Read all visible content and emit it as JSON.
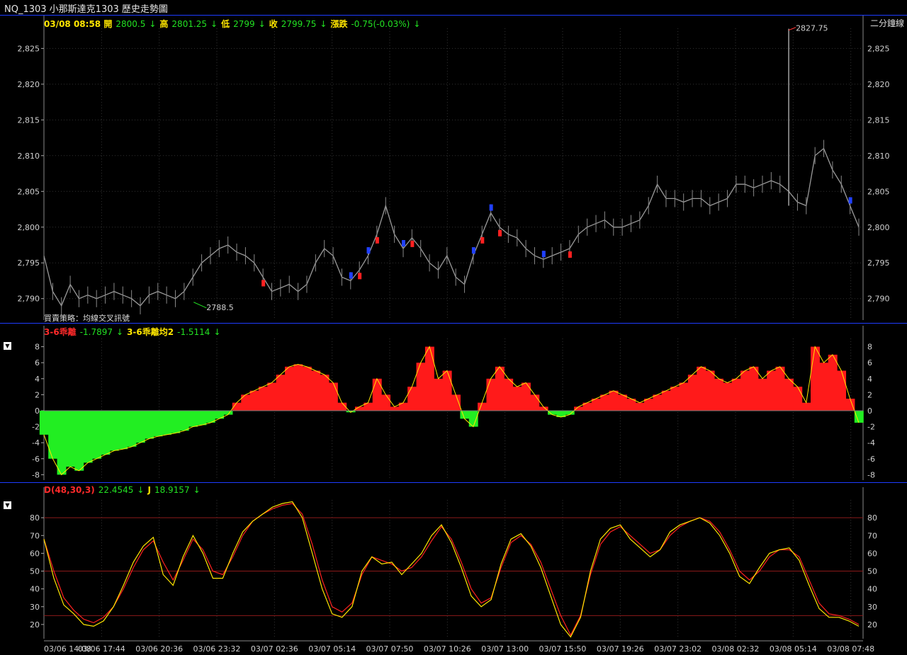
{
  "window": {
    "title": "NQ_1303 小那斯達克1303  歷史走勢圖"
  },
  "price_pane": {
    "header": [
      {
        "label": "03/08 08:58 開",
        "value": "2800.5",
        "arrow": "↓"
      },
      {
        "label": "高",
        "value": "2801.25",
        "arrow": "↓"
      },
      {
        "label": "低",
        "value": "2799",
        "arrow": "↓"
      },
      {
        "label": "收",
        "value": "2799.75",
        "arrow": "↓"
      },
      {
        "label": "漲跌",
        "value": "-0.75(-0.03%)",
        "arrow": "↓"
      }
    ],
    "right_label": "二分鐘線",
    "strategy_label": "買賣策略：均線交叉訊號",
    "high_marker": "2827.75",
    "low_marker": "2788.5",
    "y_ticks": [
      "2,825",
      "2,820",
      "2,815",
      "2,810",
      "2,805",
      "2,800",
      "2,795",
      "2,790"
    ]
  },
  "osc_pane": {
    "toggle": "▼",
    "header": [
      {
        "label": "3-6乖離",
        "value": "-1.7897",
        "arrow": "↓",
        "color": "red"
      },
      {
        "label": "3-6乖離均2",
        "value": "-1.5114",
        "arrow": "↓",
        "color": "yellow"
      }
    ],
    "y_ticks": [
      "8",
      "6",
      "4",
      "2",
      "0",
      "-2",
      "-4",
      "-6",
      "-8"
    ]
  },
  "kd_pane": {
    "toggle": "▼",
    "header": [
      {
        "label": "D(48,30,3)",
        "value": "22.4545",
        "arrow": "↓",
        "color": "red"
      },
      {
        "label": "J",
        "value": "18.9157",
        "arrow": "↓",
        "color": "yellow"
      }
    ],
    "y_ticks": [
      "80",
      "70",
      "60",
      "50",
      "40",
      "30",
      "20"
    ]
  },
  "x_ticks": [
    "03/06 14:08",
    "03/06 17:44",
    "03/06 20:36",
    "03/06 23:32",
    "03/07 02:36",
    "03/07 05:14",
    "03/07 07:50",
    "03/07 10:26",
    "03/07 13:00",
    "03/07 15:50",
    "03/07 19:26",
    "03/07 23:02",
    "03/08 02:32",
    "03/08 05:14",
    "03/08 07:48"
  ],
  "chart_data": [
    {
      "type": "line",
      "name": "price",
      "ylim": [
        2787,
        2829
      ],
      "y": [
        2796,
        2791,
        2789,
        2792,
        2790,
        2790.5,
        2790,
        2790.5,
        2791,
        2790.5,
        2790,
        2789,
        2790.5,
        2791,
        2790.5,
        2790,
        2791,
        2793,
        2795,
        2796,
        2797,
        2797.5,
        2796.5,
        2796,
        2795,
        2793,
        2791,
        2791.5,
        2792,
        2791,
        2792,
        2795,
        2797,
        2796,
        2793,
        2792.5,
        2794,
        2796,
        2799,
        2803,
        2799,
        2797,
        2798.5,
        2797,
        2795,
        2794,
        2796,
        2793,
        2792,
        2796,
        2799,
        2802,
        2800,
        2799,
        2798.5,
        2797,
        2796,
        2795.5,
        2796,
        2796.5,
        2797,
        2799,
        2800,
        2800.5,
        2801,
        2800,
        2800,
        2800.5,
        2801,
        2803,
        2806,
        2804,
        2804,
        2803.5,
        2804,
        2804,
        2803,
        2803.5,
        2804,
        2806,
        2806,
        2805.5,
        2806,
        2806.5,
        2806,
        2805,
        2803.5,
        2803,
        2810,
        2811,
        2808,
        2806,
        2803,
        2800
      ],
      "spike": 2827.75
    },
    {
      "type": "bar",
      "name": "3-6乖離",
      "ylim": [
        -9,
        9
      ],
      "values": [
        -3,
        -6,
        -8,
        -7,
        -7.5,
        -6.5,
        -6,
        -5.5,
        -5,
        -4.8,
        -4.5,
        -4,
        -3.5,
        -3.2,
        -3,
        -2.8,
        -2.5,
        -2,
        -1.8,
        -1.5,
        -1,
        -0.5,
        1,
        2,
        2.5,
        3,
        3.5,
        4.5,
        5.5,
        5.8,
        5.5,
        5,
        4.5,
        3.5,
        1,
        -0.2,
        0.5,
        1,
        4,
        2,
        0.5,
        1,
        3,
        6,
        8,
        4,
        5,
        2,
        -1,
        -2,
        1,
        4,
        5.5,
        4,
        3,
        3.5,
        2,
        0.5,
        -0.5,
        -0.8,
        -0.5,
        0.5,
        1,
        1.5,
        2,
        2.5,
        2,
        1.5,
        1,
        1.5,
        2,
        2.5,
        3,
        3.5,
        4.5,
        5.5,
        5,
        4,
        3.5,
        4,
        5,
        5.5,
        4,
        5,
        5.5,
        4,
        3,
        1,
        8,
        6,
        7,
        5,
        1.5,
        -1.5
      ]
    },
    {
      "type": "line",
      "name": "KD",
      "ylim": [
        12,
        90
      ],
      "d": [
        68,
        50,
        35,
        28,
        23,
        21,
        24,
        30,
        40,
        52,
        62,
        67,
        55,
        45,
        56,
        68,
        62,
        50,
        48,
        58,
        70,
        78,
        82,
        85,
        87,
        88,
        82,
        65,
        45,
        30,
        27,
        32,
        48,
        58,
        56,
        54,
        50,
        52,
        58,
        67,
        75,
        68,
        55,
        40,
        32,
        35,
        52,
        66,
        70,
        65,
        55,
        40,
        25,
        14,
        25,
        48,
        65,
        72,
        75,
        70,
        65,
        60,
        62,
        70,
        75,
        78,
        80,
        78,
        72,
        62,
        50,
        45,
        50,
        58,
        62,
        62,
        58,
        45,
        32,
        26,
        25,
        23,
        20
      ],
      "j": [
        68,
        46,
        31,
        26,
        20,
        19,
        22,
        30,
        42,
        55,
        64,
        69,
        48,
        42,
        58,
        70,
        60,
        46,
        46,
        60,
        72,
        78,
        82,
        86,
        88,
        89,
        80,
        60,
        40,
        26,
        24,
        30,
        50,
        58,
        54,
        55,
        48,
        54,
        60,
        70,
        76,
        66,
        52,
        36,
        30,
        34,
        54,
        68,
        71,
        64,
        52,
        36,
        20,
        13,
        24,
        50,
        68,
        74,
        76,
        68,
        63,
        58,
        62,
        72,
        76,
        78,
        80,
        77,
        70,
        60,
        47,
        43,
        52,
        60,
        62,
        63,
        56,
        42,
        29,
        24,
        24,
        22,
        19
      ]
    }
  ]
}
